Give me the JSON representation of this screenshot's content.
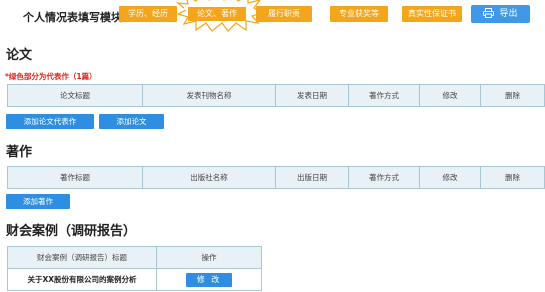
{
  "header": {
    "page_label": "个人情况表填写模块 -",
    "tabs": [
      {
        "label": "学历、经历",
        "active": false
      },
      {
        "label": "论文、著作",
        "active": true
      },
      {
        "label": "履行职责",
        "active": false
      },
      {
        "label": "专业获奖等",
        "active": false
      },
      {
        "label": "真实性保证书",
        "active": false
      }
    ],
    "export_label": "导出"
  },
  "papers": {
    "title": "论文",
    "note": "*绿色部分为代表作（1篇）",
    "columns": [
      "论文标题",
      "发表刊物名称",
      "发表日期",
      "著作方式",
      "修改",
      "删除"
    ],
    "add_rep_label": "添加论文代表作",
    "add_label": "添加论文"
  },
  "books": {
    "title": "著作",
    "columns": [
      "著作标题",
      "出版社名称",
      "出版日期",
      "著作方式",
      "修改",
      "删除"
    ],
    "add_label": "添加著作"
  },
  "cases": {
    "title": "财会案例（调研报告）",
    "columns": [
      "财会案例（调研报告）标题",
      "操作"
    ],
    "rows": [
      {
        "title": "关于XX股份有限公司的案例分析",
        "action": "修 改"
      }
    ]
  },
  "colors": {
    "tab_orange": "#f3a51c",
    "button_blue": "#2e8fe2",
    "header_cell_bg": "#e8f1f5",
    "note_red": "#e3241b"
  }
}
